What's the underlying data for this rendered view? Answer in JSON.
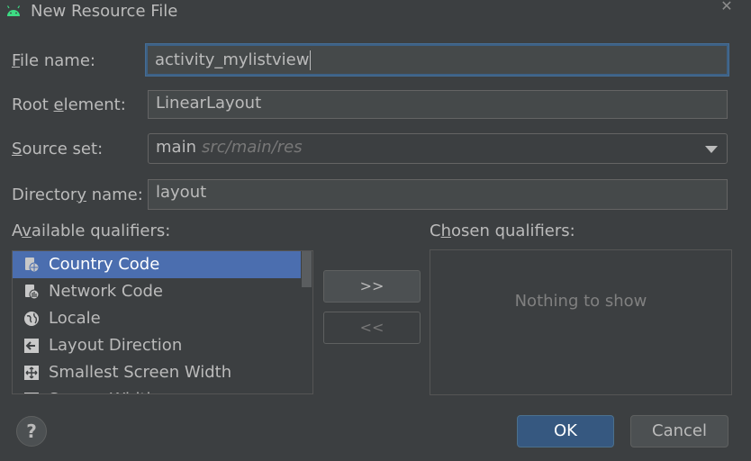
{
  "window": {
    "title": "New Resource File",
    "close_icon": "close-icon"
  },
  "form": {
    "file_name": {
      "label_pre": "",
      "label_mnemonic": "F",
      "label_post": "ile name:",
      "value": "activity_mylistview"
    },
    "root_element": {
      "label_pre": "Root ",
      "label_mnemonic": "e",
      "label_post": "lement:",
      "value": "LinearLayout"
    },
    "source_set": {
      "label_pre": "",
      "label_mnemonic": "S",
      "label_post": "ource set:",
      "value": "main",
      "hint": "src/main/res"
    },
    "directory_name": {
      "label_pre": "Director",
      "label_mnemonic": "y",
      "label_post": " name:",
      "value": "layout"
    }
  },
  "available": {
    "label_pre": "A",
    "label_mnemonic": "v",
    "label_post": "ailable qualifiers:",
    "items": [
      {
        "label": "Country Code",
        "icon": "country-code-icon",
        "selected": true
      },
      {
        "label": "Network Code",
        "icon": "network-code-icon",
        "selected": false
      },
      {
        "label": "Locale",
        "icon": "globe-icon",
        "selected": false
      },
      {
        "label": "Layout Direction",
        "icon": "layout-direction-icon",
        "selected": false
      },
      {
        "label": "Smallest Screen Width",
        "icon": "screen-width-icon",
        "selected": false
      },
      {
        "label": "Screen Width",
        "icon": "screen-width-icon",
        "selected": false
      }
    ]
  },
  "chosen": {
    "label_pre": "C",
    "label_mnemonic": "h",
    "label_post": "osen qualifiers:",
    "empty_text": "Nothing to show"
  },
  "buttons": {
    "add": ">>",
    "remove": "<<",
    "help": "?",
    "ok": "OK",
    "cancel": "Cancel"
  },
  "colors": {
    "background": "#3c3f41",
    "selection": "#4b6eaf",
    "ok_button": "#365880",
    "focus_border": "#3d6185"
  }
}
